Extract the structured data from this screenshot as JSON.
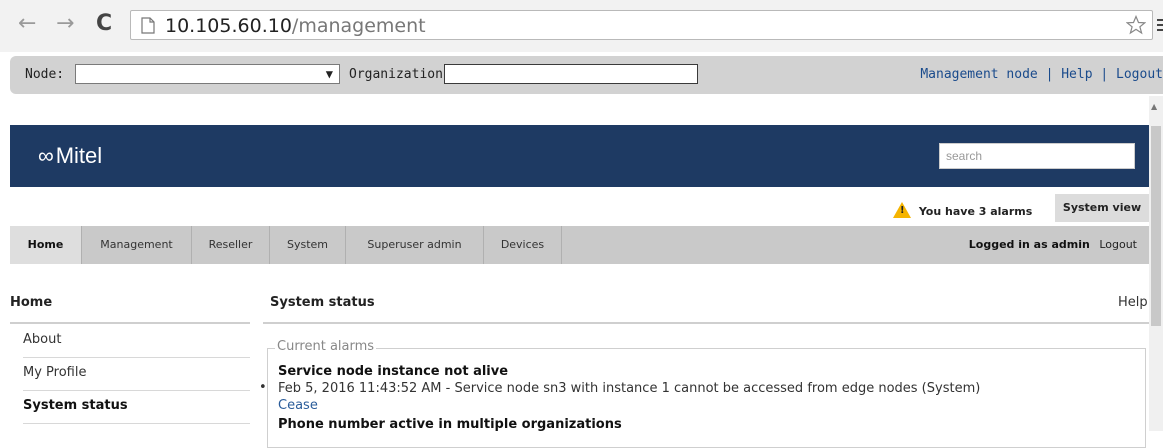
{
  "browser": {
    "url_host": "10.105.60.10",
    "url_path": "/management"
  },
  "management_bar": {
    "node_label": "Node:",
    "node_value": "",
    "organization_label": "Organization:",
    "organization_value": "",
    "links": [
      "Management node",
      "Help",
      "Logout"
    ]
  },
  "header": {
    "logo_text": "Mitel",
    "search_placeholder": "search"
  },
  "alarm_strip": {
    "alarms_text": "You have 3 alarms",
    "system_view": "System view"
  },
  "tabs": [
    {
      "label": "Home",
      "active": true
    },
    {
      "label": "Management",
      "active": false
    },
    {
      "label": "Reseller",
      "active": false
    },
    {
      "label": "System",
      "active": false
    },
    {
      "label": "Superuser admin",
      "active": false
    },
    {
      "label": "Devices",
      "active": false
    }
  ],
  "user": {
    "logged_in_text": "Logged in as admin",
    "logout_label": "Logout"
  },
  "left_nav": {
    "title": "Home",
    "items": [
      {
        "label": "About",
        "selected": false
      },
      {
        "label": "My Profile",
        "selected": false
      },
      {
        "label": "System status",
        "selected": true
      }
    ]
  },
  "main": {
    "title": "System status",
    "help_label": "Help",
    "legend": "Current alarms",
    "alarms": [
      {
        "title": "Service node instance not alive",
        "description": "Feb 5, 2016 11:43:52 AM - Service node sn3 with instance 1 cannot be accessed from edge nodes (System)",
        "action": "Cease"
      },
      {
        "title": "Phone number active in multiple organizations"
      }
    ]
  },
  "colors": {
    "header_bg": "#1e3a63",
    "link_blue": "#1a4b8c",
    "warning_yellow": "#f5b400"
  }
}
